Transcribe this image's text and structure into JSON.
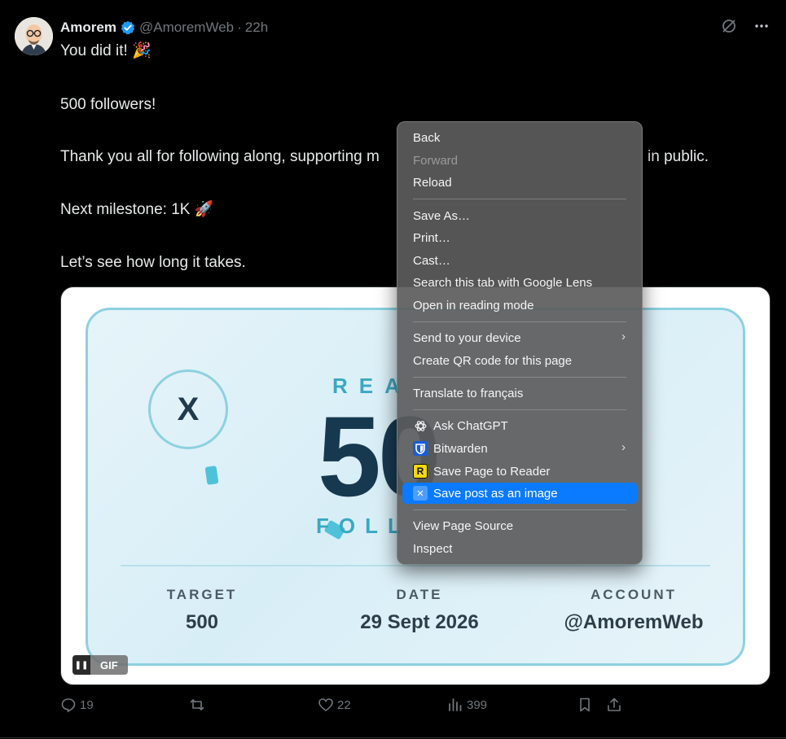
{
  "post": {
    "author_name": "Amorem",
    "handle": "@AmoremWeb",
    "separator": "·",
    "time": "22h",
    "icons": {
      "grok": "grok-icon",
      "more": "more-icon",
      "verified": "verified-badge-icon"
    },
    "text": {
      "line1": "You did it! 🎉",
      "line2": "500 followers!",
      "line3": "Thank you all for following along, supporting m",
      "line3_tail": "in public.",
      "line4": "Next milestone: 1K 🚀",
      "line5": "Let’s see how long it takes."
    },
    "media": {
      "x_logo": "X",
      "headline_top": "REA",
      "big_number": "50",
      "headline_bottom": "FOLL",
      "stats": [
        {
          "label": "TARGET",
          "value": "500"
        },
        {
          "label": "DATE",
          "value": "29 Sept 2026"
        },
        {
          "label": "ACCOUNT",
          "value": "@AmoremWeb"
        }
      ],
      "gif_label": "GIF",
      "pause_glyph": "❚❚",
      "accent_color": "#3aa8c2"
    },
    "actions": {
      "replies": "19",
      "likes": "22",
      "views": "399"
    }
  },
  "context_menu": {
    "items": [
      {
        "label": "Back",
        "state": "enabled"
      },
      {
        "label": "Forward",
        "state": "disabled"
      },
      {
        "label": "Reload",
        "state": "enabled"
      },
      {
        "label": "Save As…",
        "state": "enabled"
      },
      {
        "label": "Print…",
        "state": "enabled"
      },
      {
        "label": "Cast…",
        "state": "enabled"
      },
      {
        "label": "Search this tab with Google Lens",
        "state": "enabled"
      },
      {
        "label": "Open in reading mode",
        "state": "enabled"
      },
      {
        "label": "Send to your device",
        "state": "enabled",
        "submenu": true
      },
      {
        "label": "Create QR code for this page",
        "state": "enabled"
      },
      {
        "label": "Translate to français",
        "state": "enabled"
      },
      {
        "label": "Ask ChatGPT",
        "state": "enabled",
        "icon": "chatgpt-icon"
      },
      {
        "label": "Bitwarden",
        "state": "enabled",
        "icon": "bitwarden-icon",
        "submenu": true
      },
      {
        "label": "Save Page to Reader",
        "state": "enabled",
        "icon": "reader-icon",
        "icon_glyph": "R"
      },
      {
        "label": "Save post as an image",
        "state": "selected",
        "icon": "x-extension-icon",
        "icon_glyph": "✕"
      },
      {
        "label": "View Page Source",
        "state": "enabled"
      },
      {
        "label": "Inspect",
        "state": "enabled"
      }
    ],
    "submenu_glyph": "›",
    "highlight_color": "#0a7aff"
  }
}
